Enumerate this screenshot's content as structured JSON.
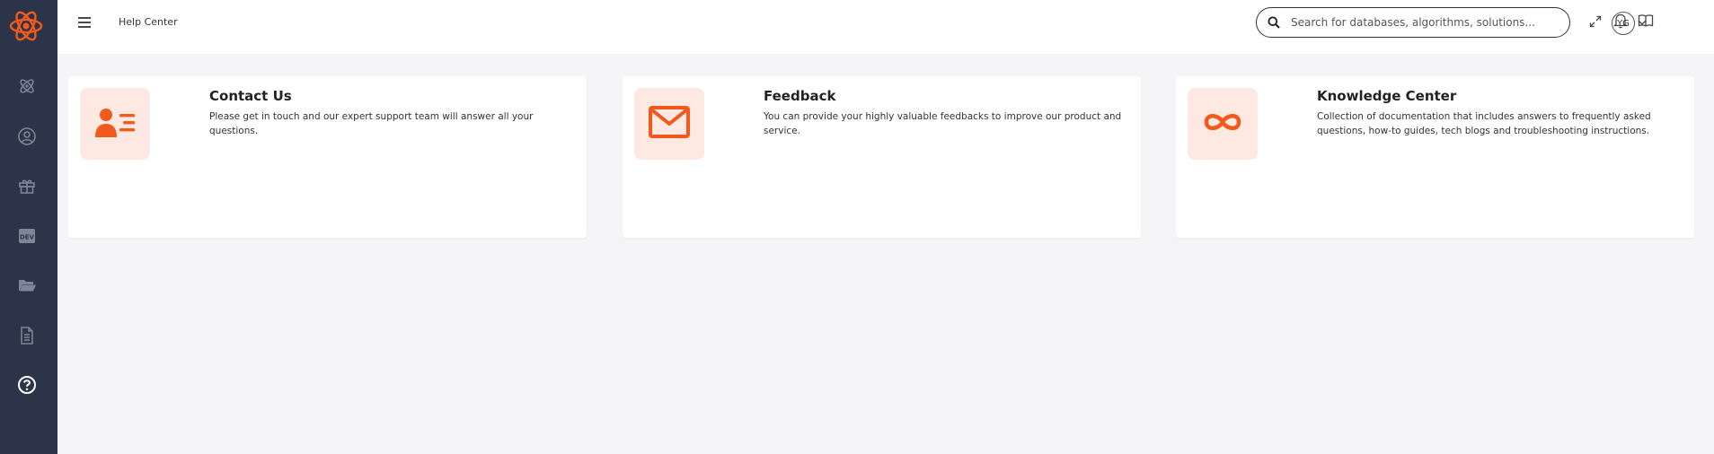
{
  "header": {
    "title": "Help Center",
    "search_placeholder": "Search for databases, algorithms, solutions...",
    "avatar_initials": "YG"
  },
  "sidebar": {
    "items": [
      {
        "icon": "atom-icon"
      },
      {
        "icon": "user-circle-icon"
      },
      {
        "icon": "gift-icon"
      },
      {
        "icon": "dev-icon",
        "label": "DEV"
      },
      {
        "icon": "folder-open-icon"
      },
      {
        "icon": "document-icon"
      },
      {
        "icon": "help-circle-icon"
      }
    ]
  },
  "cards": [
    {
      "title": "Contact Us",
      "description": "Please get in touch and our expert support team will answer all your questions.",
      "icon": "contact-card-icon"
    },
    {
      "title": "Feedback",
      "description": "You can provide your highly valuable feedbacks to improve our product and service.",
      "icon": "envelope-icon"
    },
    {
      "title": "Knowledge Center",
      "description": "Collection of documentation that includes answers to frequently asked questions, how-to guides, tech blogs and troubleshooting instructions.",
      "icon": "infinity-icon"
    }
  ],
  "colors": {
    "accent": "#f15a1c",
    "sidebar_bg": "#2c3449",
    "icon_tile_bg": "#fde9e1",
    "page_bg": "#f5f5f8"
  }
}
